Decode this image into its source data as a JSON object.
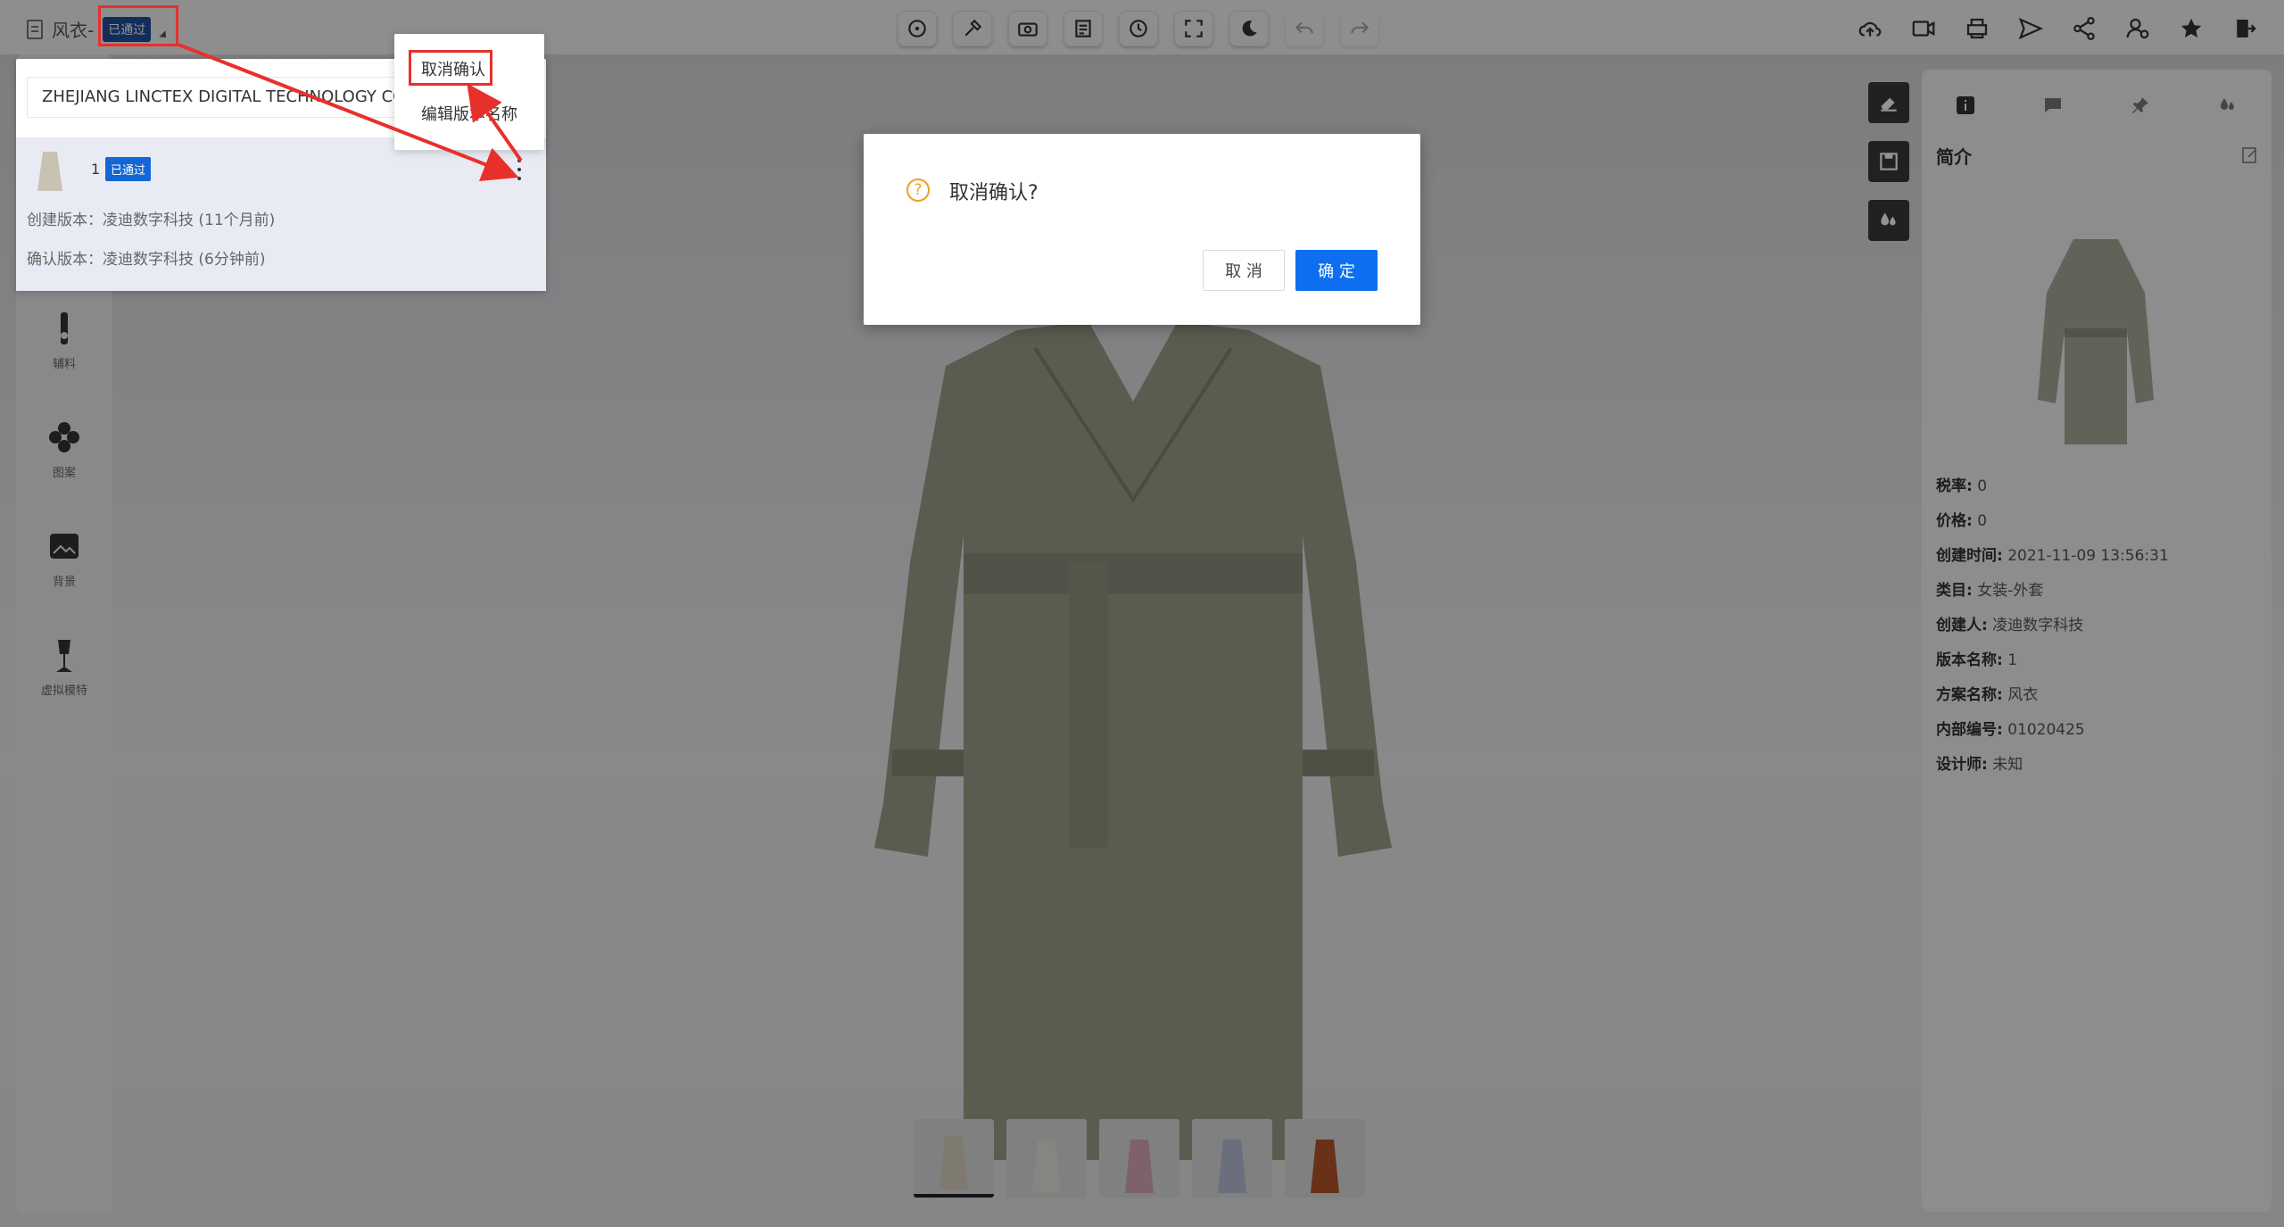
{
  "topbar": {
    "doc_title": "风衣-",
    "status_badge": "已通过",
    "tools_center": [
      "rotate-view-icon",
      "tools-icon",
      "camera-icon",
      "document-icon",
      "history-icon",
      "fullscreen-icon",
      "night-mode-icon",
      "undo-icon",
      "redo-icon"
    ],
    "tools_right": [
      "cloud-upload-icon",
      "video-icon",
      "printer-icon",
      "send-icon",
      "share-icon",
      "user-settings-icon",
      "star-icon",
      "exit-icon"
    ]
  },
  "left_sidebar": {
    "items": [
      {
        "label": "辅料",
        "icon": "zipper-icon"
      },
      {
        "label": "图案",
        "icon": "pattern-icon"
      },
      {
        "label": "背景",
        "icon": "background-icon"
      },
      {
        "label": "虚拟模特",
        "icon": "mannequin-icon"
      }
    ]
  },
  "version_panel": {
    "company": "ZHEJIANG LINCTEX DIGITAL TECHNOLOGY CO",
    "item": {
      "number": "1",
      "badge": "已通过",
      "created": "创建版本：凌迪数字科技 (11个月前)",
      "confirmed": "确认版本：凌迪数字科技 (6分钟前)"
    }
  },
  "context_menu": {
    "cancel_confirm": "取消确认",
    "edit_version_name": "编辑版本名称"
  },
  "dialog": {
    "title": "取消确认?",
    "cancel": "取 消",
    "ok": "确 定"
  },
  "right_panel": {
    "tabs": [
      "info-icon",
      "comment-icon",
      "pin-icon",
      "color-drop-icon"
    ],
    "title": "简介",
    "props": [
      {
        "key": "税率:",
        "value": "0"
      },
      {
        "key": "价格:",
        "value": "0"
      },
      {
        "key": "创建时间:",
        "value": "2021-11-09 13:56:31"
      },
      {
        "key": "类目:",
        "value": "女装-外套"
      },
      {
        "key": "创建人:",
        "value": "凌迪数字科技"
      },
      {
        "key": "版本名称:",
        "value": "1"
      },
      {
        "key": "方案名称:",
        "value": "风衣"
      },
      {
        "key": "内部编号:",
        "value": "01020425"
      },
      {
        "key": "设计师:",
        "value": "未知"
      }
    ]
  },
  "thumbnails": [
    "trench-coat-front",
    "trench-coat-front-2",
    "pink-check-coat",
    "navy-coat",
    "rust-coat"
  ],
  "colors": {
    "accent_blue": "#0d6ef0",
    "badge_blue": "#1366d6",
    "annotation_red": "#e8302b",
    "garment_olive": "#9aa08a"
  }
}
